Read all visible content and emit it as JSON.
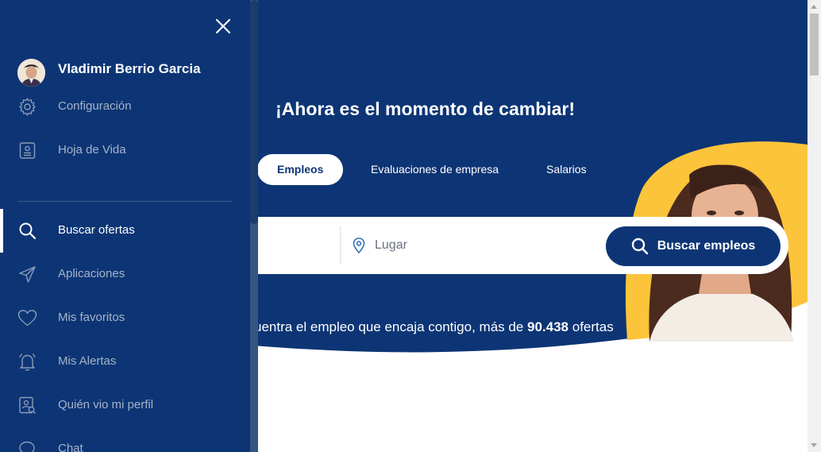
{
  "sidebar": {
    "close_label": "close",
    "user": {
      "name": "Vladimir Berrio Garcia"
    },
    "top_items": [
      {
        "label": "Configuración",
        "icon": "gear-icon"
      },
      {
        "label": "Hoja de Vida",
        "icon": "resume-icon"
      }
    ],
    "items": [
      {
        "label": "Buscar ofertas",
        "icon": "search-icon",
        "active": true
      },
      {
        "label": "Aplicaciones",
        "icon": "send-icon"
      },
      {
        "label": "Mis favoritos",
        "icon": "heart-icon"
      },
      {
        "label": "Mis Alertas",
        "icon": "bell-icon"
      },
      {
        "label": "Quién vio mi perfil",
        "icon": "profile-view-icon"
      },
      {
        "label": "Chat",
        "icon": "chat-icon"
      }
    ]
  },
  "hero": {
    "title": "¡Ahora es el momento de cambiar!",
    "tabs": [
      {
        "label": "Empleos",
        "active": true
      },
      {
        "label": "Evaluaciones de empresa"
      },
      {
        "label": "Salarios"
      }
    ],
    "search": {
      "location_placeholder": "Lugar",
      "button_label": "Buscar empleos"
    },
    "tagline_prefix": "uentra el empleo que encaja contigo, más de ",
    "tagline_count": "90.438",
    "tagline_suffix": " ofertas"
  },
  "colors": {
    "brand_navy": "#0d3575",
    "accent_yellow": "#fbc43a",
    "sidebar_text_muted": "#a6b3c9"
  }
}
